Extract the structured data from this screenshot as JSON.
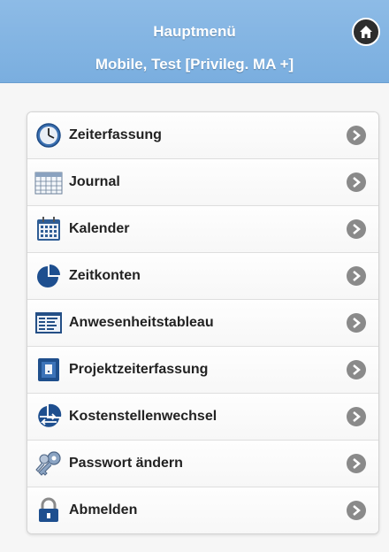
{
  "header": {
    "title": "Hauptmenü",
    "subtitle": "Mobile, Test [Privileg. MA +]",
    "home_icon": "home-icon",
    "bg_color": "#80b3e2"
  },
  "menu": {
    "items": [
      {
        "label": "Zeiterfassung",
        "icon": "clock-icon"
      },
      {
        "label": "Journal",
        "icon": "journal-icon"
      },
      {
        "label": "Kalender",
        "icon": "calendar-icon"
      },
      {
        "label": "Zeitkonten",
        "icon": "pie-chart-icon"
      },
      {
        "label": "Anwesenheitstableau",
        "icon": "attendance-board-icon"
      },
      {
        "label": "Projektzeiterfassung",
        "icon": "project-icon"
      },
      {
        "label": "Kostenstellenwechsel",
        "icon": "cost-center-switch-icon"
      },
      {
        "label": "Passwort ändern",
        "icon": "keys-icon"
      },
      {
        "label": "Abmelden",
        "icon": "lock-icon"
      }
    ],
    "arrow_icon": "chevron-right-icon"
  }
}
